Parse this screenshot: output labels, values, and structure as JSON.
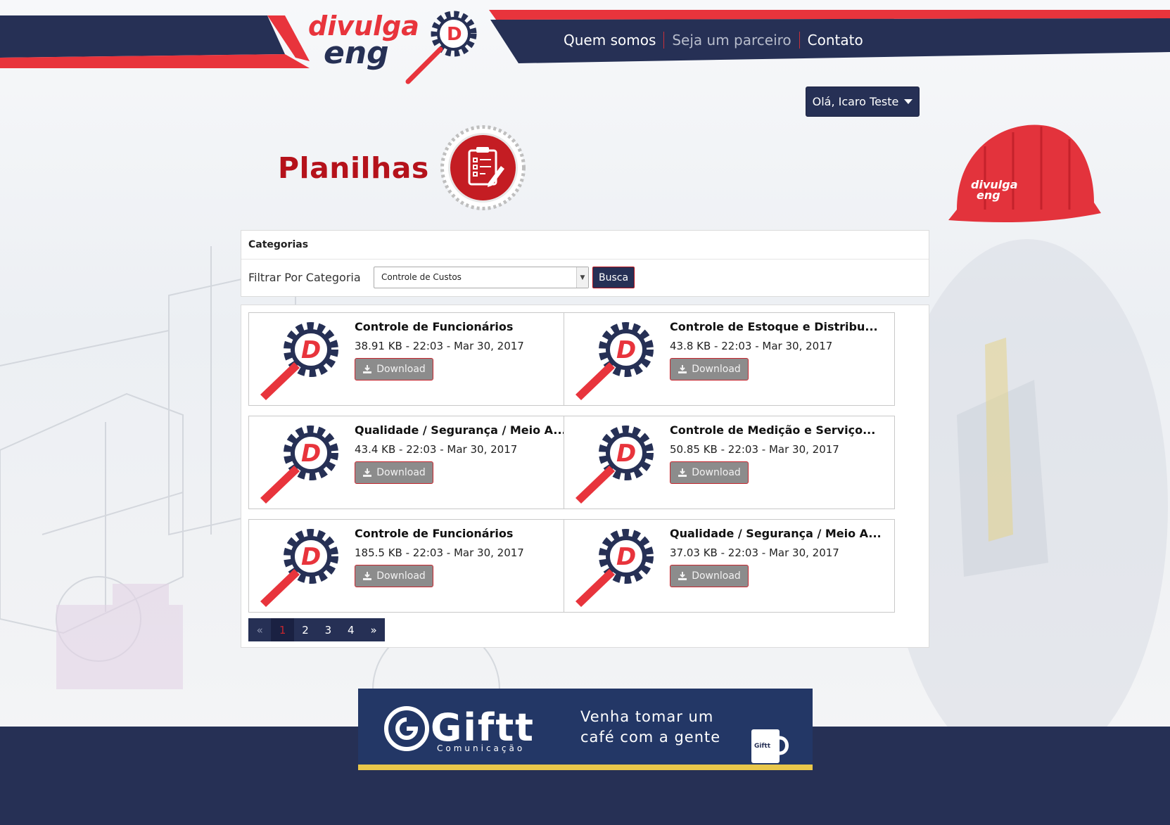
{
  "nav": {
    "items": [
      {
        "label": "Quem somos"
      },
      {
        "label": "Seja um parceiro"
      },
      {
        "label": "Contato"
      }
    ]
  },
  "logo": {
    "text_top": "divulga",
    "text_bottom": "eng",
    "mark": "D"
  },
  "user": {
    "greeting": "Olá, Icaro Teste"
  },
  "page": {
    "title": "Planilhas",
    "icon": "clipboard-icon"
  },
  "filter": {
    "header": "Categorias",
    "label": "Filtrar Por Categoria",
    "selected": "Controle de Custos",
    "button": "Busca"
  },
  "files": [
    {
      "name": "Controle de Funcionários",
      "meta": "38.91 KB - 22:03 - Mar 30, 2017",
      "action": "Download"
    },
    {
      "name": "Controle de Estoque e Distribu...",
      "meta": "43.8 KB - 22:03 - Mar 30, 2017",
      "action": "Download"
    },
    {
      "name": "Qualidade / Segurança / Meio A...",
      "meta": "43.4 KB - 22:03 - Mar 30, 2017",
      "action": "Download"
    },
    {
      "name": "Controle de Medição e Serviço...",
      "meta": "50.85 KB - 22:03 - Mar 30, 2017",
      "action": "Download"
    },
    {
      "name": "Controle de Funcionários",
      "meta": "185.5 KB - 22:03 - Mar 30, 2017",
      "action": "Download"
    },
    {
      "name": "Qualidade / Segurança / Meio A...",
      "meta": "37.03 KB - 22:03 - Mar 30, 2017",
      "action": "Download"
    }
  ],
  "pagination": {
    "prev": "«",
    "pages": [
      "1",
      "2",
      "3",
      "4"
    ],
    "current": "1",
    "next": "»"
  },
  "ad": {
    "brand": "Giftt",
    "brand_sub": "Comunicação",
    "line1": "Venha tomar um",
    "line2": "café com a gente",
    "mug_label": "Giftt"
  },
  "colors": {
    "navy": "#263055",
    "red": "#b5121b",
    "accent_red": "#e8343c",
    "gold": "#e9c74a"
  }
}
